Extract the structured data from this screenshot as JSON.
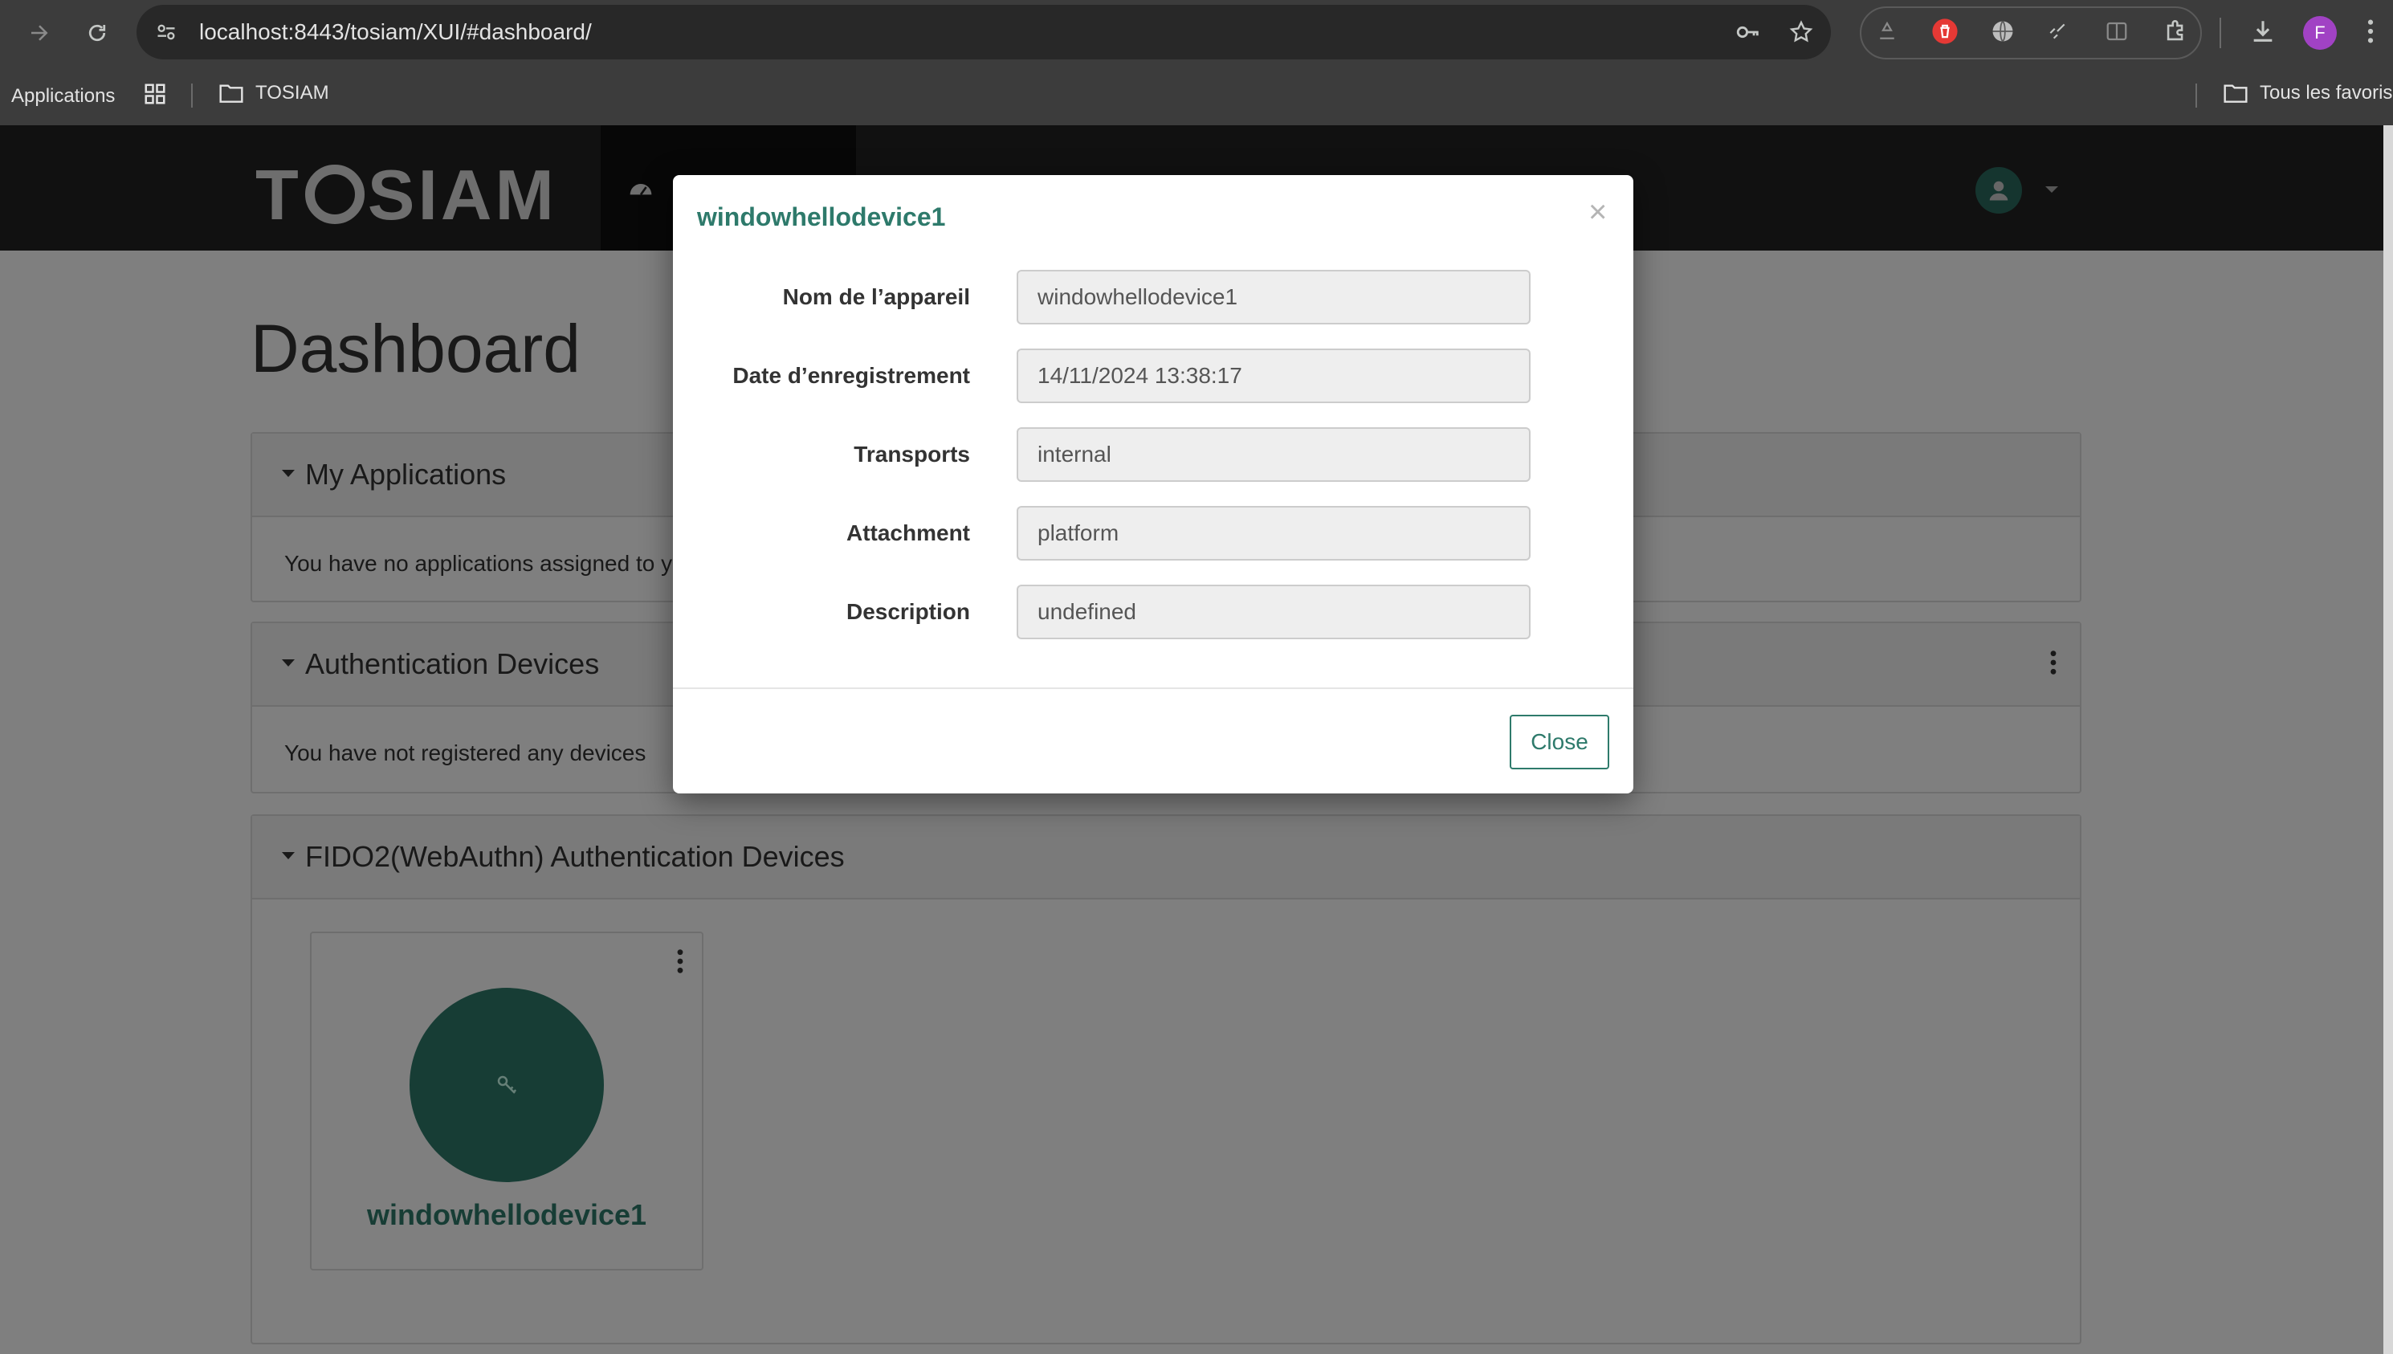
{
  "browser": {
    "url": "localhost:8443/tosiam/XUI/#dashboard/",
    "bookmarks": {
      "apps_label": "Applications",
      "folder_label": "TOSIAM",
      "all_favorites_label": "Tous les favoris"
    },
    "profile_initial": "F",
    "profile_color": "#a142c4"
  },
  "app": {
    "logo_text_left": "T",
    "logo_text_right": "SIAM",
    "page_title": "Dashboard",
    "accent_color": "#2e7a6b",
    "panels": {
      "applications": {
        "title": "My Applications",
        "message": "You have no applications assigned to y"
      },
      "devices": {
        "title": "Authentication Devices",
        "message": "You have not registered any devices"
      },
      "fido": {
        "title": "FIDO2(WebAuthn) Authentication Devices",
        "device_name": "windowhellodevice1",
        "device_icon": "key-icon"
      }
    }
  },
  "modal": {
    "title": "windowhellodevice1",
    "close_x": "×",
    "fields": [
      {
        "label": "Nom de l’appareil",
        "value": "windowhellodevice1"
      },
      {
        "label": "Date d’enregistrement",
        "value": "14/11/2024 13:38:17"
      },
      {
        "label": "Transports",
        "value": "internal"
      },
      {
        "label": "Attachment",
        "value": "platform"
      },
      {
        "label": "Description",
        "value": "undefined"
      }
    ],
    "close_button": "Close"
  }
}
